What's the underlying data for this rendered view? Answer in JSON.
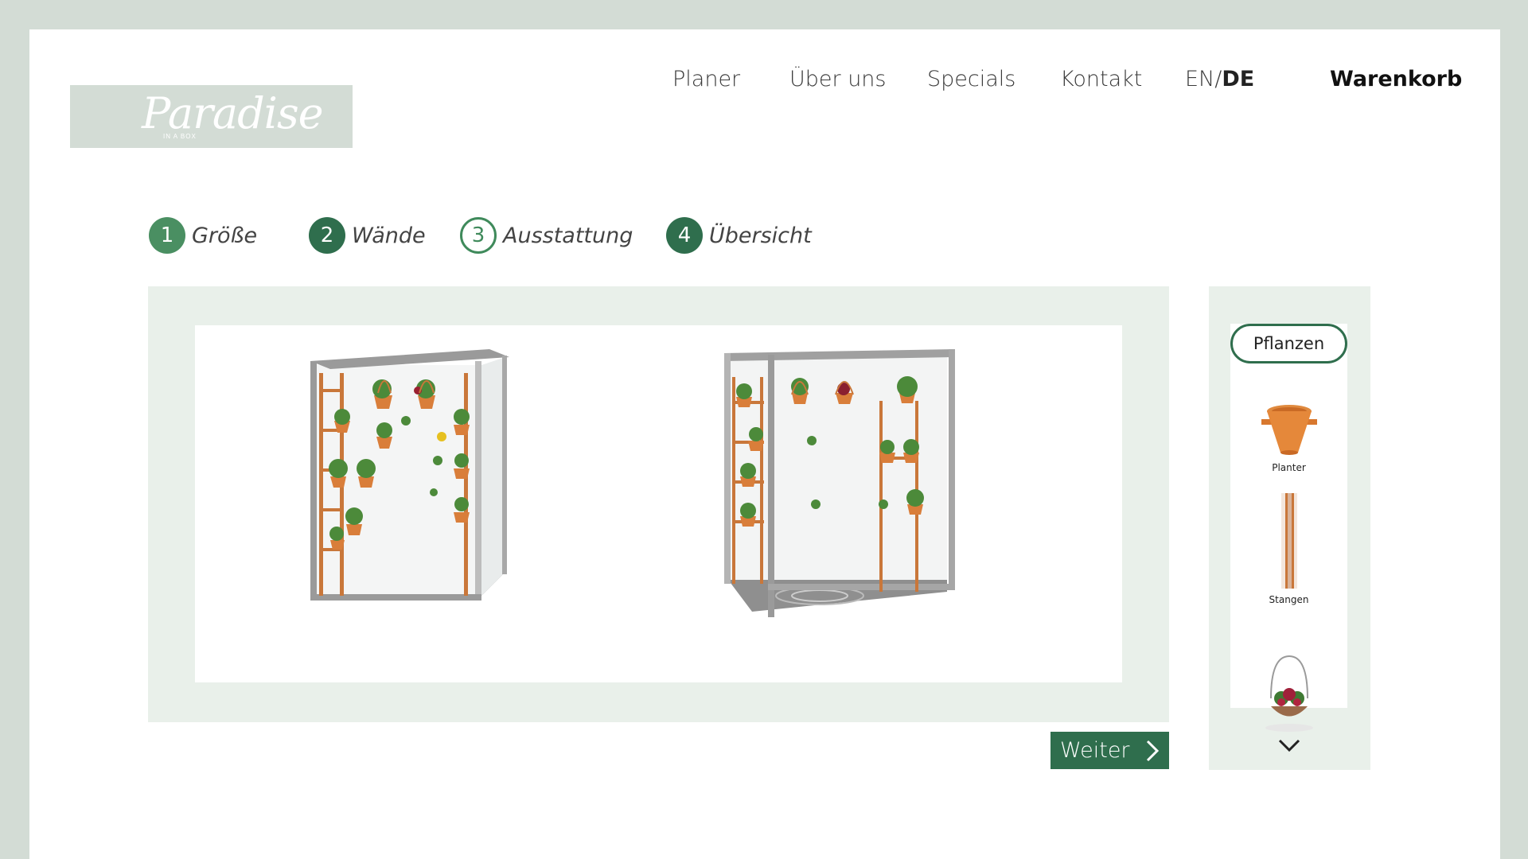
{
  "logo": {
    "text": "Paradise",
    "subtext": "IN A BOX"
  },
  "nav": {
    "items": [
      "Planer",
      "Über uns",
      "Specials",
      "Kontakt"
    ],
    "lang_en": "EN",
    "lang_sep": "/",
    "lang_de": "DE",
    "cart": "Warenkorb"
  },
  "steps": [
    {
      "number": "1",
      "label": "Größe"
    },
    {
      "number": "2",
      "label": "Wände"
    },
    {
      "number": "3",
      "label": "Ausstattung"
    },
    {
      "number": "4",
      "label": "Übersicht"
    }
  ],
  "next_button": {
    "label": "Weiter"
  },
  "side_panel": {
    "category": "Pflanzen",
    "items": [
      {
        "label": "Planter",
        "icon": "planter-icon"
      },
      {
        "label": "Stangen",
        "icon": "pole-icon"
      },
      {
        "label": "",
        "icon": "hanging-basket-icon"
      }
    ]
  },
  "colors": {
    "background": "#d3dcd5",
    "panel": "#e9f0ea",
    "accent": "#2f6e4d",
    "terracotta": "#d97e3a"
  }
}
